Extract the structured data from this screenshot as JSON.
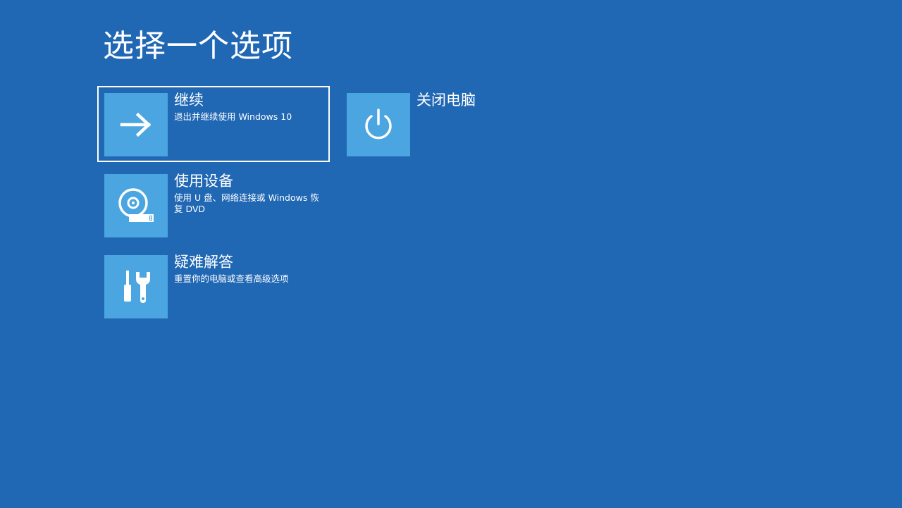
{
  "page": {
    "title": "选择一个选项"
  },
  "options": [
    {
      "id": "continue",
      "title": "继续",
      "description": "退出并继续使用 Windows 10",
      "icon": "arrow-right-icon",
      "selected": true
    },
    {
      "id": "use-device",
      "title": "使用设备",
      "description": "使用 U 盘、网络连接或 Windows 恢复 DVD",
      "icon": "disc-usb-icon",
      "selected": false
    },
    {
      "id": "troubleshoot",
      "title": "疑难解答",
      "description": "重置你的电脑或查看高级选项",
      "icon": "tools-icon",
      "selected": false
    },
    {
      "id": "shutdown",
      "title": "关闭电脑",
      "description": "",
      "icon": "power-icon",
      "selected": false
    }
  ],
  "colors": {
    "background": "#2067b4",
    "tile": "#4ba5e0",
    "text": "#ffffff",
    "selection_border": "#ffffff"
  }
}
